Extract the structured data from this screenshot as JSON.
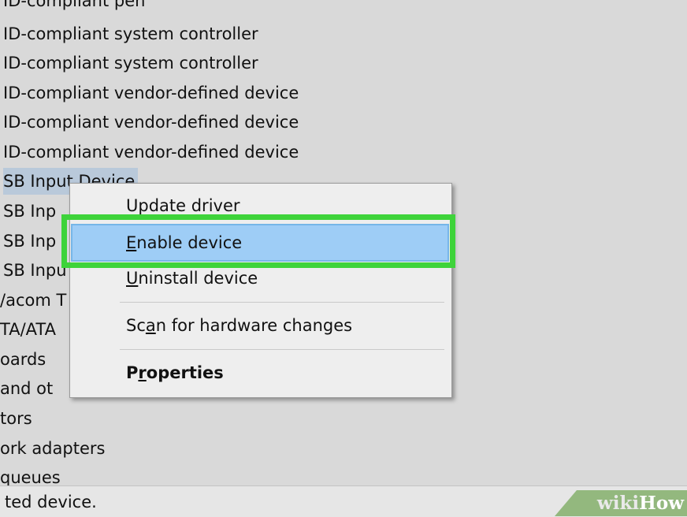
{
  "device_list": [
    "ID-compliant pen",
    "ID-compliant system controller",
    "ID-compliant system controller",
    "ID-compliant vendor-defined device",
    "ID-compliant vendor-defined device",
    "ID-compliant vendor-defined device",
    "SB Input Device",
    "SB Inp",
    "SB Inp",
    "SB Inpu",
    "/acom T",
    "TA/ATA",
    "oards",
    "and ot",
    "tors",
    "ork adapters",
    "queues"
  ],
  "context_menu": {
    "update_driver": {
      "pre": "Update driver",
      "key": "",
      "post": ""
    },
    "enable_device": {
      "pre": "",
      "key": "E",
      "post": "nable device"
    },
    "uninstall_device": {
      "pre": "",
      "key": "U",
      "post": "ninstall device"
    },
    "scan_hardware": {
      "pre": "Sc",
      "key": "a",
      "post": "n for hardware changes"
    },
    "properties": {
      "pre": "P",
      "key": "r",
      "post": "operties"
    }
  },
  "status_bar": {
    "text": "ted device."
  },
  "watermark": {
    "part1": "wiki",
    "part2": "How"
  },
  "colors": {
    "highlight_box": "#3ed33a",
    "menu_hover": "#9ecdf6",
    "selected_row": "#b9c9da",
    "watermark_bg": "#93b87e"
  }
}
